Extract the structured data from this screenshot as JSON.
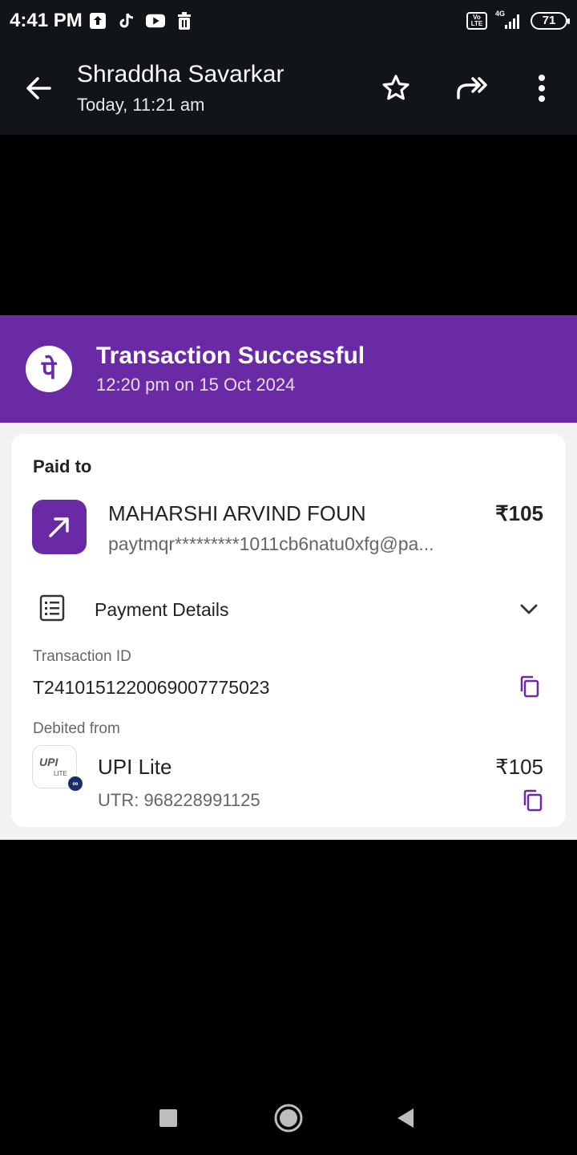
{
  "status_bar": {
    "time": "4:41 PM",
    "left_icons": [
      "upload-icon",
      "tiktok-icon",
      "youtube-icon",
      "trash-icon"
    ],
    "network": "4G",
    "volte": "Vo LTE",
    "battery": "71"
  },
  "app_bar": {
    "title": "Shraddha Savarkar",
    "subtitle": "Today, 11:21 am",
    "actions": [
      "star-icon",
      "forward-icon",
      "more-vertical-icon"
    ]
  },
  "receipt": {
    "status_title": "Transaction Successful",
    "status_time": "12:20 pm on 15 Oct 2024",
    "logo_glyph": "पे",
    "paid_to_label": "Paid to",
    "merchant_name": "MAHARSHI ARVIND FOUN",
    "merchant_vpa": "paytmqr*********1011cb6natu0xfg@pa...",
    "amount": "₹105",
    "payment_details_label": "Payment Details",
    "transaction_id_label": "Transaction ID",
    "transaction_id": "T2410151220069007775023",
    "debited_from_label": "Debited from",
    "source_name": "UPI Lite",
    "source_amount": "₹105",
    "utr": "UTR: 968228991125",
    "upi_logo_text": "UPI",
    "upi_logo_sub": "LITE"
  },
  "colors": {
    "brand_purple": "#6a2aa6",
    "app_bar_bg": "#111418"
  }
}
